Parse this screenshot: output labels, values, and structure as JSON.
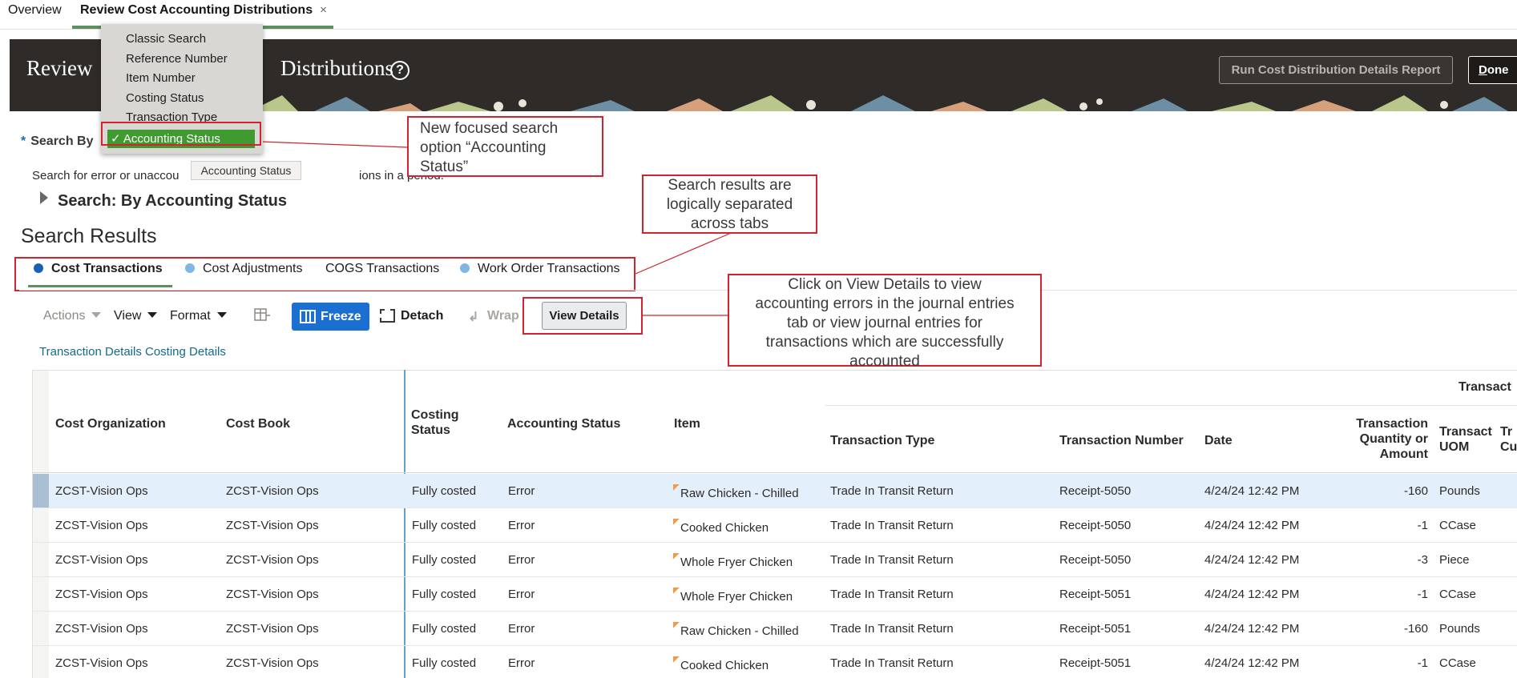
{
  "app_tabs": [
    {
      "label": "Overview"
    },
    {
      "label": "Review Cost Accounting Distributions",
      "close": "×"
    }
  ],
  "header": {
    "title_start": "Review",
    "title_end": "Distributions",
    "help": "?",
    "run_report_label": "Run Cost Distribution Details Report",
    "done_label": "Done",
    "done_mnemonic": "D",
    "done_rest": "one"
  },
  "search": {
    "search_by_label": "Search By",
    "required_marker": "*",
    "dropdown_options": [
      "Classic Search",
      "Reference Number",
      "Item Number",
      "Costing Status",
      "Transaction Type"
    ],
    "selected_option": "✓ Accounting Status",
    "tooltip": "Accounting Status",
    "help_text_a": "Search for error or unaccou",
    "help_text_b": "ions in a period.",
    "disclosure_label": "Search: By Accounting Status"
  },
  "results": {
    "heading": "Search Results",
    "tabs": [
      {
        "label": "Cost Transactions",
        "dot_color": "#1a5fb4"
      },
      {
        "label": "Cost Adjustments",
        "dot_color": "#7fb6e6"
      },
      {
        "label": "COGS Transactions",
        "dot_color": ""
      },
      {
        "label": "Work Order Transactions",
        "dot_color": "#7fb6e6"
      }
    ]
  },
  "annotations": {
    "a1": [
      "New focused search",
      "option “Accounting",
      "Status”"
    ],
    "a2": [
      "Search results are",
      "logically separated",
      "across tabs"
    ],
    "a3": [
      "Click on View Details to view",
      "accounting errors in the journal entries",
      "tab or view journal entries for",
      "transactions which are successfully",
      "accounted"
    ]
  },
  "toolbar": {
    "actions": "Actions",
    "view": "View",
    "format": "Format",
    "freeze": "Freeze",
    "detach": "Detach",
    "wrap": "Wrap",
    "view_details": "View Details"
  },
  "links_row": "Transaction Details Costing Details",
  "table": {
    "group_header": "Transact",
    "headers": {
      "cost_org": "Cost Organization",
      "cost_book": "Cost Book",
      "costing_status_1": "Costing",
      "costing_status_2": "Status",
      "accounting_status": "Accounting Status",
      "item": "Item",
      "transaction_type": "Transaction Type",
      "transaction_number": "Transaction Number",
      "date": "Date",
      "qty_1": "Transaction",
      "qty_2": "Quantity or",
      "qty_3": "Amount",
      "uom_1": "Transact",
      "uom_2": "UOM",
      "tr_1": "Tr",
      "tr_2": "Cu"
    },
    "rows": [
      {
        "cost_org": "ZCST-Vision Ops",
        "cost_book": "ZCST-Vision Ops",
        "costing_status": "Fully costed",
        "accounting_status": "Error",
        "item": "Raw Chicken - Chilled",
        "transaction_type": "Trade In Transit Return",
        "transaction_number": "Receipt-5050",
        "date": "4/24/24 12:42 PM",
        "qty": "-160",
        "uom": "Pounds"
      },
      {
        "cost_org": "ZCST-Vision Ops",
        "cost_book": "ZCST-Vision Ops",
        "costing_status": "Fully costed",
        "accounting_status": "Error",
        "item": "Cooked Chicken",
        "transaction_type": "Trade In Transit Return",
        "transaction_number": "Receipt-5050",
        "date": "4/24/24 12:42 PM",
        "qty": "-1",
        "uom": "CCase"
      },
      {
        "cost_org": "ZCST-Vision Ops",
        "cost_book": "ZCST-Vision Ops",
        "costing_status": "Fully costed",
        "accounting_status": "Error",
        "item": "Whole Fryer Chicken",
        "transaction_type": "Trade In Transit Return",
        "transaction_number": "Receipt-5050",
        "date": "4/24/24 12:42 PM",
        "qty": "-3",
        "uom": "Piece"
      },
      {
        "cost_org": "ZCST-Vision Ops",
        "cost_book": "ZCST-Vision Ops",
        "costing_status": "Fully costed",
        "accounting_status": "Error",
        "item": "Whole Fryer Chicken",
        "transaction_type": "Trade In Transit Return",
        "transaction_number": "Receipt-5051",
        "date": "4/24/24 12:42 PM",
        "qty": "-1",
        "uom": "CCase"
      },
      {
        "cost_org": "ZCST-Vision Ops",
        "cost_book": "ZCST-Vision Ops",
        "costing_status": "Fully costed",
        "accounting_status": "Error",
        "item": "Raw Chicken - Chilled",
        "transaction_type": "Trade In Transit Return",
        "transaction_number": "Receipt-5051",
        "date": "4/24/24 12:42 PM",
        "qty": "-160",
        "uom": "Pounds"
      },
      {
        "cost_org": "ZCST-Vision Ops",
        "cost_book": "ZCST-Vision Ops",
        "costing_status": "Fully costed",
        "accounting_status": "Error",
        "item": "Cooked Chicken",
        "transaction_type": "Trade In Transit Return",
        "transaction_number": "Receipt-5051",
        "date": "4/24/24 12:42 PM",
        "qty": "-1",
        "uom": "CCase"
      }
    ]
  },
  "colors": {
    "accent_green": "#5e8f5f",
    "annotation_red": "#d3232e",
    "freeze_blue": "#1a6fd1",
    "selected_green": "#3f9a2f"
  }
}
